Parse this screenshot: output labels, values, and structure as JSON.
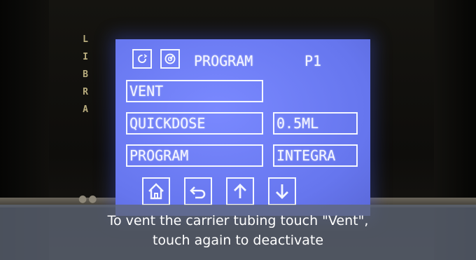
{
  "device": {
    "brand_letters": [
      "L",
      "I",
      "B",
      "R",
      "A"
    ]
  },
  "screen": {
    "header": {
      "title": "PROGRAM",
      "program_id": "P1",
      "icons": [
        "power-cycle-icon",
        "settings-gauge-icon"
      ]
    },
    "buttons": {
      "vent": "VENT",
      "quickdose": "QUICKDOSE",
      "quickdose_value": "0.5ML",
      "program": "PROGRAM",
      "integra": "INTEGRA"
    },
    "nav_icons": [
      "home-icon",
      "back-icon",
      "arrow-up-icon",
      "arrow-down-icon"
    ]
  },
  "caption": {
    "line1": "To vent the carrier tubing touch \"Vent\",",
    "line2": "touch again to deactivate"
  },
  "colors": {
    "lcd_background": "#6f7ef6",
    "lcd_foreground": "#f4f6ff",
    "caption_background": "#5f6776"
  }
}
